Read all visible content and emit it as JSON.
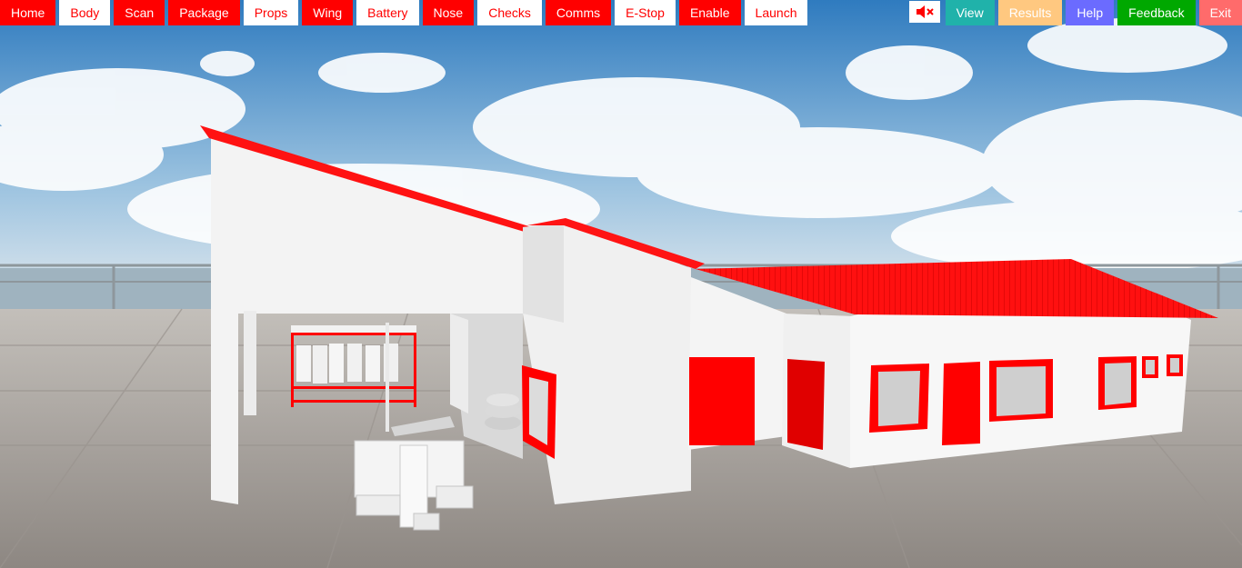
{
  "nav": {
    "items": [
      {
        "label": "Home",
        "style": "red"
      },
      {
        "label": "Body",
        "style": "white"
      },
      {
        "label": "Scan",
        "style": "red"
      },
      {
        "label": "Package",
        "style": "red"
      },
      {
        "label": "Props",
        "style": "white"
      },
      {
        "label": "Wing",
        "style": "red"
      },
      {
        "label": "Battery",
        "style": "white"
      },
      {
        "label": "Nose",
        "style": "red"
      },
      {
        "label": "Checks",
        "style": "white"
      },
      {
        "label": "Comms",
        "style": "red"
      },
      {
        "label": "E-Stop",
        "style": "white"
      },
      {
        "label": "Enable",
        "style": "red"
      },
      {
        "label": "Launch",
        "style": "white"
      }
    ]
  },
  "controls": {
    "mute_icon": "speaker-muted-icon",
    "view": {
      "label": "View",
      "color": "#20b2aa"
    },
    "results": {
      "label": "Results",
      "color": "#ffc880"
    },
    "help": {
      "label": "Help",
      "color": "#6b6bff"
    },
    "feedback": {
      "label": "Feedback",
      "color": "#00a800"
    },
    "exit": {
      "label": "Exit",
      "color": "#ff6b6b"
    }
  },
  "colors": {
    "accent_red": "#ff0000",
    "sky_top": "#2f7bbf",
    "sky_bottom": "#dfe8ef",
    "ground": "#a8a29c"
  }
}
